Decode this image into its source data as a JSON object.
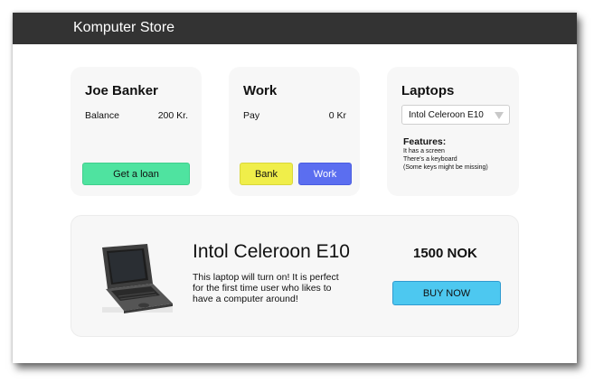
{
  "app": {
    "title": "Komputer Store"
  },
  "bank": {
    "name": "Joe Banker",
    "balance_label": "Balance",
    "balance_value": "200 Kr.",
    "loan_button": "Get a loan"
  },
  "work": {
    "title": "Work",
    "pay_label": "Pay",
    "pay_value": "0 Kr",
    "bank_button": "Bank",
    "work_button": "Work"
  },
  "laptops": {
    "title": "Laptops",
    "selected": "Intol Celeroon E10",
    "features_title": "Features:",
    "features": [
      "It has a screen",
      "There's a keyboard",
      "(Some keys might be missing)"
    ]
  },
  "product": {
    "name": "Intol Celeroon E10",
    "description": "This laptop will turn on! It is perfect for the first time user who likes to have a computer around!",
    "price": "1500 NOK",
    "buy_button": "BUY NOW"
  },
  "colors": {
    "topbar": "#333333",
    "loan_button": "#4fe3a0",
    "bank_button": "#f0ee4a",
    "work_button": "#5b6ef0",
    "buy_button": "#4dc8f0"
  }
}
